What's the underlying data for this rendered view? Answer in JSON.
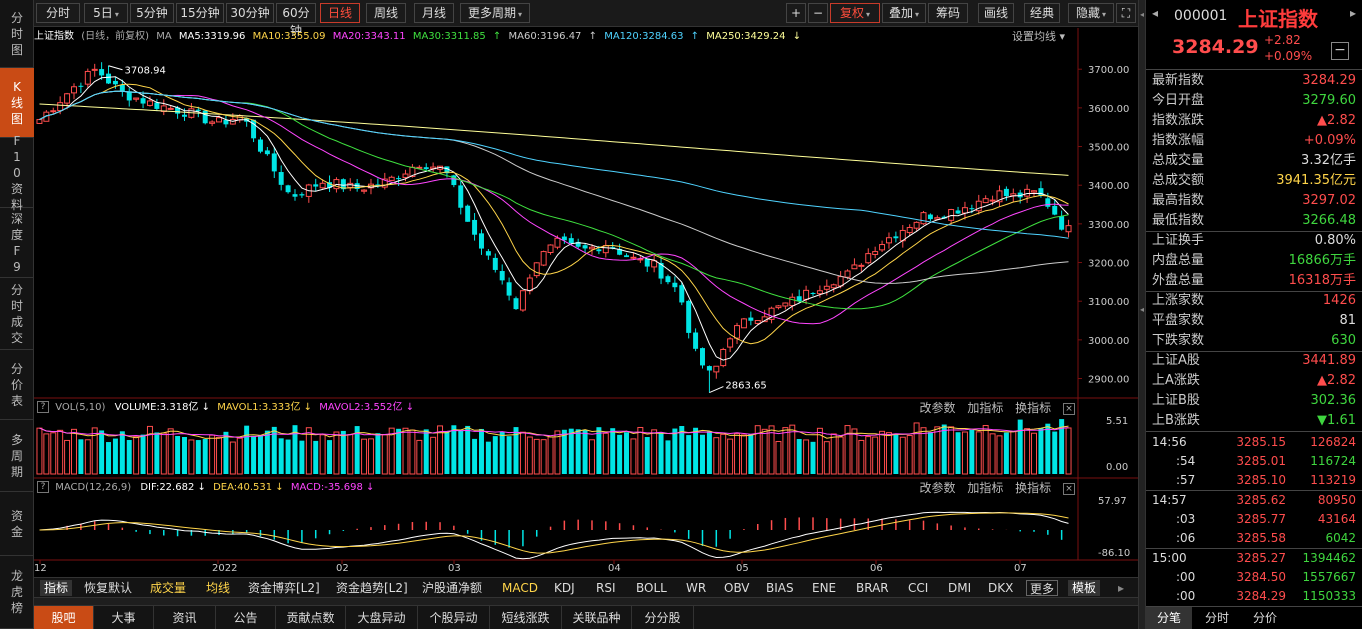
{
  "left_tabs": [
    "分时图",
    "K线图",
    "F10资料",
    "深度F9",
    "分时成交",
    "分价表",
    "多周期",
    "资金",
    "龙虎榜"
  ],
  "toolbar": {
    "left": [
      "分时",
      "5日",
      "5分钟",
      "15分钟",
      "30分钟",
      "60分钟",
      "日线",
      "周线",
      "月线",
      "更多周期"
    ],
    "right": [
      "+",
      "−",
      "复权",
      "叠加",
      "筹码",
      "画线",
      "经典",
      "隐藏"
    ]
  },
  "ma_legend": {
    "name": "上证指数",
    "mode": "(日线，前复权)",
    "ma_label": "MA",
    "items": [
      {
        "text": "MA5:3319.96",
        "color": "#ffffff"
      },
      {
        "text": "MA10:3355.09",
        "color": "#ffd54a"
      },
      {
        "text": "MA20:3343.11",
        "color": "#ff46ff"
      },
      {
        "text": "MA30:3311.85",
        "color": "#3fe03f"
      },
      {
        "text": "MA60:3196.47",
        "color": "#cccccc"
      },
      {
        "text": "MA120:3284.63",
        "color": "#4fd3ff"
      },
      {
        "text": "MA250:3429.24",
        "color": "#ffff99"
      }
    ],
    "settings": "设置均线"
  },
  "vol_legend": {
    "label": "VOL(5,10)",
    "items": [
      {
        "text": "VOLUME:3.318亿",
        "color": "#ffffff"
      },
      {
        "text": "MAVOL1:3.333亿",
        "color": "#ffd54a"
      },
      {
        "text": "MAVOL2:3.552亿",
        "color": "#ff46ff"
      }
    ]
  },
  "macd_legend": {
    "label": "MACD(12,26,9)",
    "items": [
      {
        "text": "DIF:22.682",
        "color": "#ffffff"
      },
      {
        "text": "DEA:40.531",
        "color": "#ffd54a"
      },
      {
        "text": "MACD:-35.698",
        "color": "#ff46ff"
      }
    ]
  },
  "pane_links": [
    "改参数",
    "加指标",
    "换指标"
  ],
  "chart_data": {
    "type": "candlestick",
    "title": "上证指数",
    "price_ticks": [
      "3700.00",
      "3600.00",
      "3500.00",
      "3400.00",
      "3300.00",
      "3200.00",
      "3100.00",
      "3000.00",
      "2900.00"
    ],
    "price_range": [
      2863.65,
      3708.94
    ],
    "high_label": "3708.94",
    "low_label": "2863.65",
    "vol_ticks": [
      "5.51",
      "0.00"
    ],
    "macd_ticks": [
      "57.97",
      "-86.10"
    ],
    "x_labels": [
      "12",
      "2022",
      "02",
      "03",
      "04",
      "05",
      "06",
      "07"
    ]
  },
  "indicators": [
    "指标",
    "恢复默认",
    "成交量",
    "均线",
    "资金博弈[L2]",
    "资金趋势[L2]",
    "沪股通净额",
    "MACD",
    "KDJ",
    "RSI",
    "BOLL",
    "WR",
    "OBV",
    "BIAS",
    "ENE",
    "BRAR",
    "CCI",
    "DMI",
    "DKX",
    "更多",
    "模板"
  ],
  "bottom_tabs": [
    "股吧",
    "大事",
    "资讯",
    "公告",
    "贡献点数",
    "大盘异动",
    "个股异动",
    "短线涨跌",
    "关联品种",
    "分分股"
  ],
  "quote": {
    "code": "000001",
    "name": "上证指数",
    "price": "3284.29",
    "change": "+2.82",
    "pct": "+0.09%",
    "rows": [
      {
        "label": "最新指数",
        "value": "3284.29",
        "color": "red"
      },
      {
        "label": "今日开盘",
        "value": "3279.60",
        "color": "green"
      },
      {
        "label": "指数涨跌",
        "value": "▲2.82",
        "color": "red"
      },
      {
        "label": "指数涨幅",
        "value": "+0.09%",
        "color": "red"
      },
      {
        "label": "总成交量",
        "value": "3.32亿手",
        "color": "white"
      },
      {
        "label": "总成交额",
        "value": "3941.35亿元",
        "color": "yellow"
      },
      {
        "label": "最高指数",
        "value": "3297.02",
        "color": "red"
      },
      {
        "label": "最低指数",
        "value": "3266.48",
        "color": "green"
      },
      {
        "label": "上证换手",
        "value": "0.80%",
        "color": "white"
      },
      {
        "label": "内盘总量",
        "value": "16866万手",
        "color": "green"
      },
      {
        "label": "外盘总量",
        "value": "16318万手",
        "color": "red"
      },
      {
        "label": "上涨家数",
        "value": "1426",
        "color": "red"
      },
      {
        "label": "平盘家数",
        "value": "81",
        "color": "white"
      },
      {
        "label": "下跌家数",
        "value": "630",
        "color": "green"
      },
      {
        "label": "上证A股",
        "value": "3441.89",
        "color": "red"
      },
      {
        "label": "上A涨跌",
        "value": "▲2.82",
        "color": "red"
      },
      {
        "label": "上证B股",
        "value": "302.36",
        "color": "green"
      },
      {
        "label": "上B涨跌",
        "value": "▼1.61",
        "color": "green"
      }
    ],
    "ticks": [
      {
        "time": "14:56",
        "price": "3285.15",
        "vol": "126824",
        "vcolor": "red"
      },
      {
        "time": ":54",
        "price": "3285.01",
        "vol": "116724",
        "vcolor": "green"
      },
      {
        "time": ":57",
        "price": "3285.10",
        "vol": "113219",
        "vcolor": "red"
      },
      {
        "time": "14:57",
        "price": "3285.62",
        "vol": "80950",
        "vcolor": "red"
      },
      {
        "time": ":03",
        "price": "3285.77",
        "vol": "43164",
        "vcolor": "red"
      },
      {
        "time": ":06",
        "price": "3285.58",
        "vol": "6042",
        "vcolor": "green"
      },
      {
        "time": "15:00",
        "price": "3285.27",
        "vol": "1394462",
        "vcolor": "green"
      },
      {
        "time": ":00",
        "price": "3284.50",
        "vol": "1557667",
        "vcolor": "green"
      },
      {
        "time": ":00",
        "price": "3284.29",
        "vol": "1150333",
        "vcolor": "green"
      }
    ],
    "tabs": [
      "分笔",
      "分时",
      "分价"
    ]
  }
}
